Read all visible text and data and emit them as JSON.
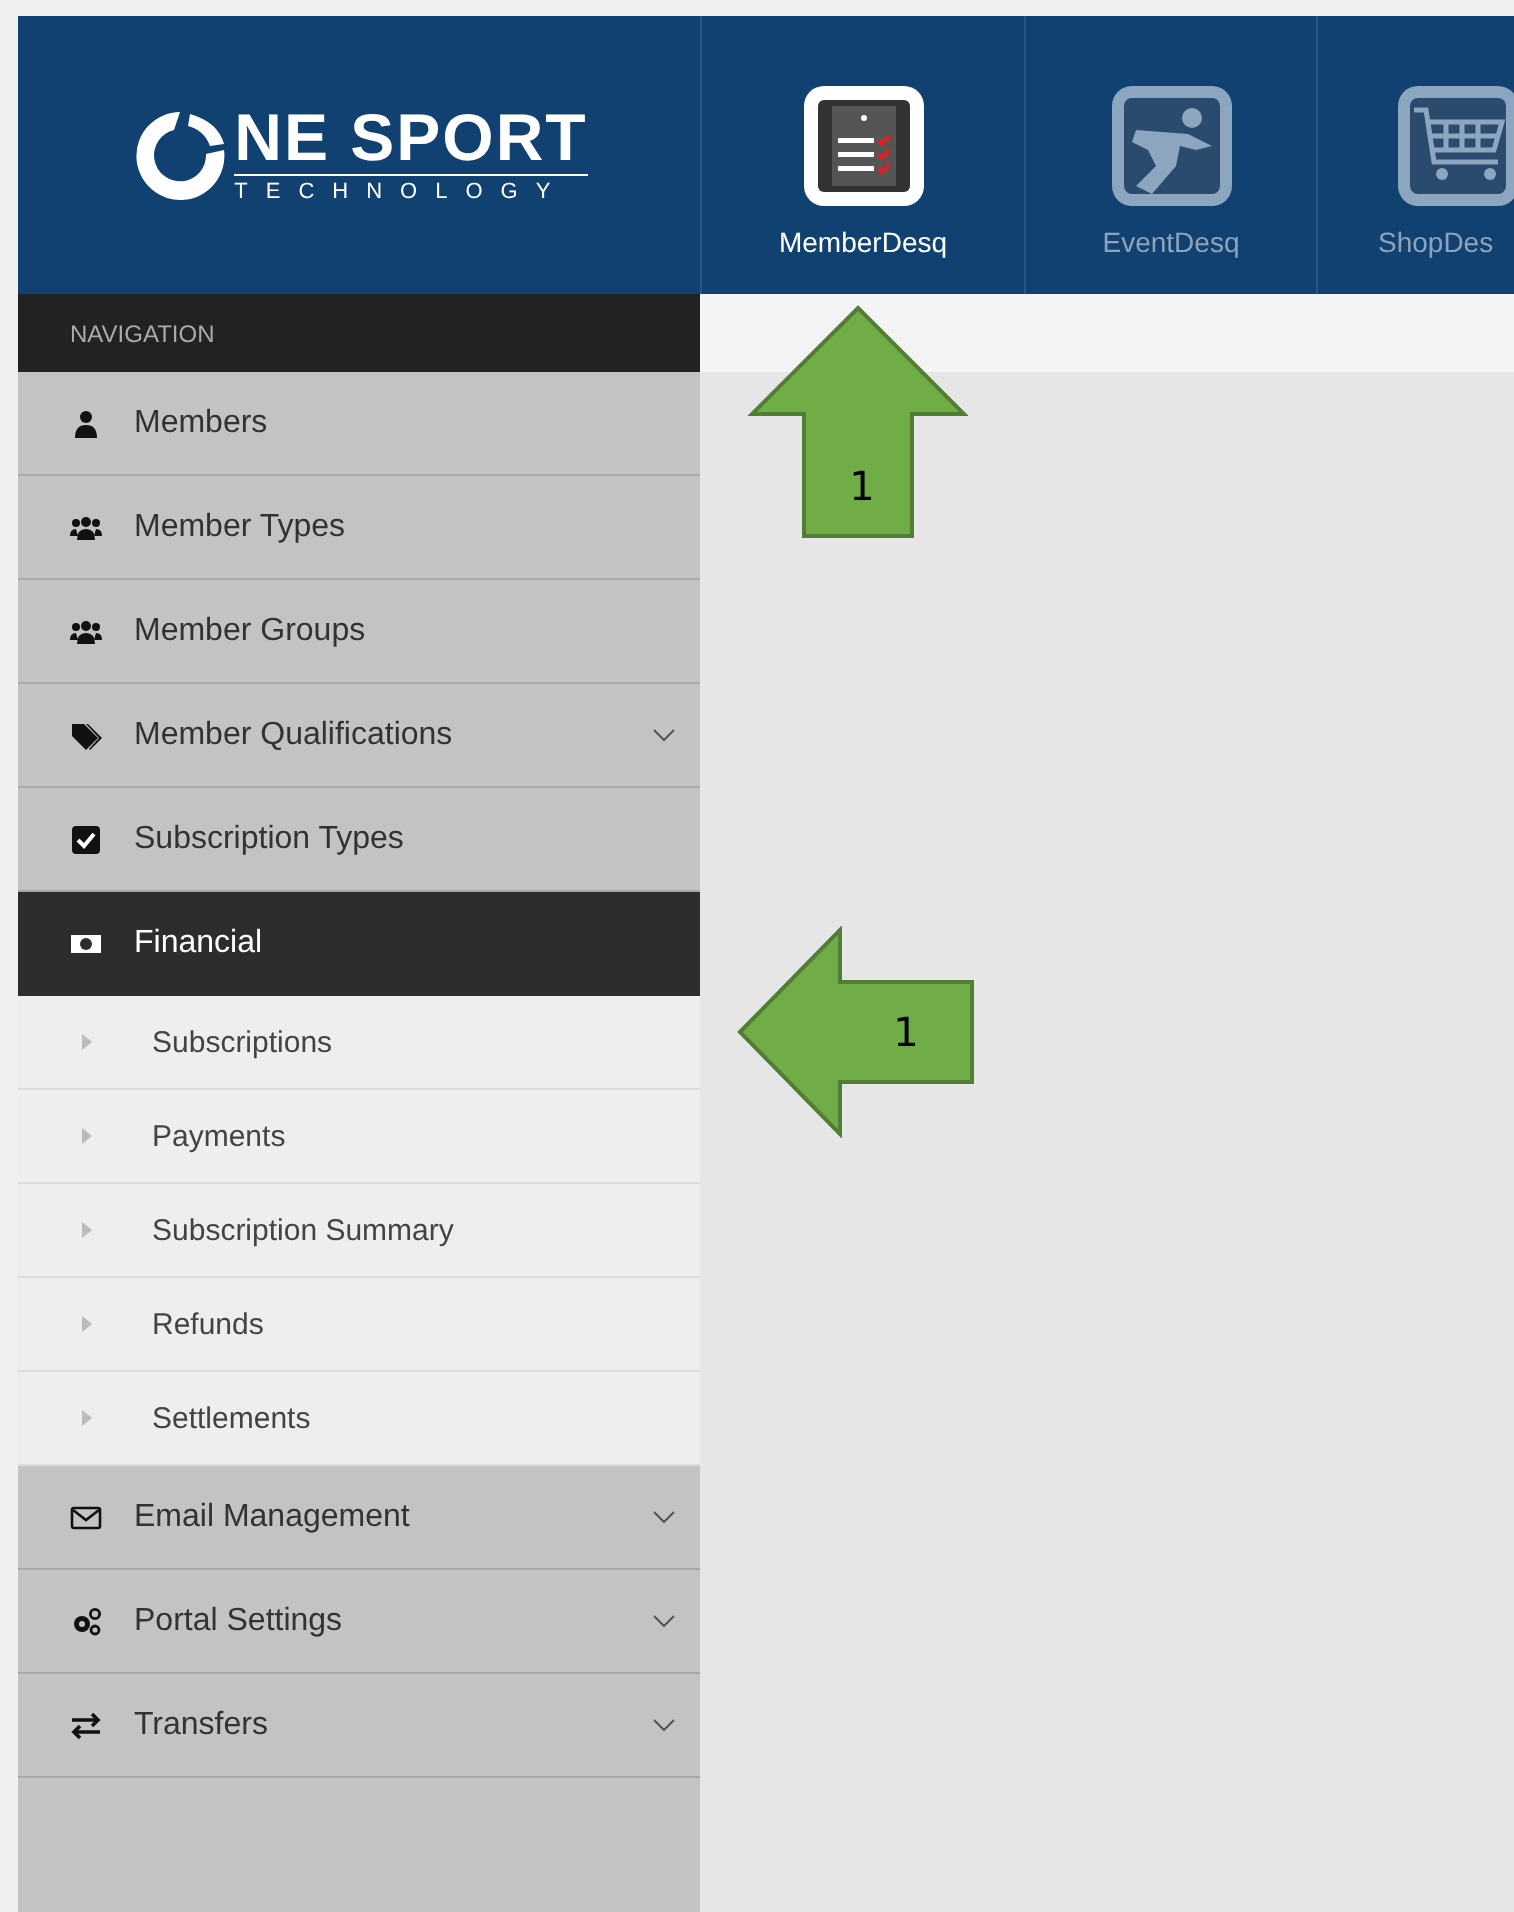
{
  "logo": {
    "main": "NE SPORT",
    "sub": "TECHNOLOGY"
  },
  "apps": [
    {
      "label": "MemberDesq",
      "kind": "members",
      "selected": true
    },
    {
      "label": "EventDesq",
      "kind": "event",
      "selected": false
    },
    {
      "label": "ShopDes",
      "kind": "shop",
      "selected": false
    }
  ],
  "sidebar": {
    "heading": "NAVIGATION",
    "items": [
      {
        "label": "Members",
        "kind": "user",
        "selected": false,
        "has_submenu": false
      },
      {
        "label": "Member Types",
        "kind": "users",
        "selected": false,
        "has_submenu": false
      },
      {
        "label": "Member Groups",
        "kind": "users",
        "selected": false,
        "has_submenu": false
      },
      {
        "label": "Member Qualifications",
        "kind": "tags",
        "selected": false,
        "has_submenu": true
      },
      {
        "label": "Subscription Types",
        "kind": "check",
        "selected": false,
        "has_submenu": false
      },
      {
        "label": "Financial",
        "kind": "money",
        "selected": true,
        "has_submenu": false,
        "children": [
          {
            "label": "Subscriptions"
          },
          {
            "label": "Payments"
          },
          {
            "label": "Subscription Summary"
          },
          {
            "label": "Refunds"
          },
          {
            "label": "Settlements"
          }
        ]
      },
      {
        "label": "Email Management",
        "kind": "mail",
        "selected": false,
        "has_submenu": true
      },
      {
        "label": "Portal Settings",
        "kind": "cogs",
        "selected": false,
        "has_submenu": true
      },
      {
        "label": "Transfers",
        "kind": "exchange",
        "selected": false,
        "has_submenu": true
      }
    ]
  },
  "annotations": [
    {
      "label": "1"
    },
    {
      "label": "1"
    }
  ]
}
